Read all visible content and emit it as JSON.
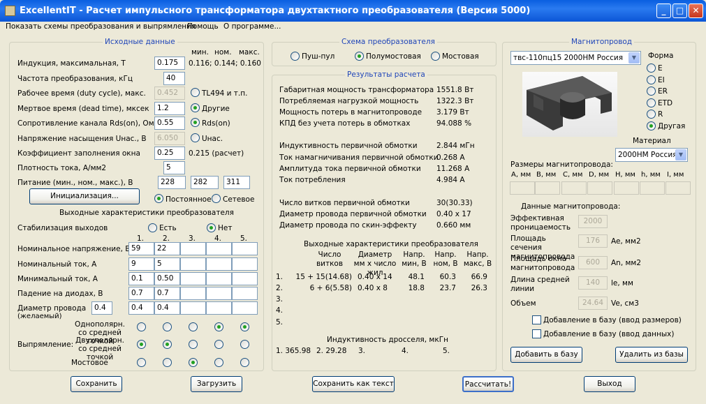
{
  "window": {
    "title": "ExcellentIT - Расчет импульсного трансформатора двухтактного преобразователя (Версия 5000)",
    "minimize": "_",
    "maximize": "□",
    "close": "✕"
  },
  "menu": {
    "schemes": "Показать схемы преобразования и выпрямления",
    "help": "Помощь",
    "about": "О программе..."
  },
  "input": {
    "title": "Исходные данные",
    "hdr_min": "мин.",
    "hdr_nom": "ном.",
    "hdr_max": "макс.",
    "induction_label": "Индукция, максимальная, Т",
    "induction_value": "0.175",
    "induction_range": "0.116; 0.144; 0.160",
    "freq_label": "Частота преобразования, кГц",
    "freq_value": "40",
    "duty_label": "Рабочее время (duty cycle), макс.",
    "duty_value": "0.452",
    "duty_opt": "TL494 и т.п.",
    "dead_label": "Мертвое время (dead time), мксек",
    "dead_value": "1.2",
    "dead_opt": "Другие",
    "rds_label": "Сопротивление канала Rds(on), Ом",
    "rds_value": "0.55",
    "rds_opt": "Rds(on)",
    "usat_label": "Напряжение насыщения Uнас., В",
    "usat_value": "6.050",
    "usat_opt": "Uнас.",
    "fill_label": "Коэффициент заполнения окна",
    "fill_value": "0.25",
    "fill_calc": "0.215 (расчет)",
    "current_density_label": "Плотность тока, А/мм2",
    "current_density_value": "5",
    "supply_label": "Питание (мин., ном., макс.), В",
    "supply_min": "228",
    "supply_nom": "282",
    "supply_max": "311",
    "init_button": "Инициализация...",
    "dc_opt": "Постоянное",
    "ac_opt": "Сетевое"
  },
  "outputs": {
    "title": "Выходные характеристики преобразователя",
    "stab_label": "Стабилизация выходов",
    "stab_yes": "Есть",
    "stab_no": "Нет",
    "col_nums": [
      "1.",
      "2.",
      "3.",
      "4.",
      "5."
    ],
    "rows": [
      {
        "label": "Номинальное напряжение, В",
        "values": [
          "59",
          "22",
          "",
          "",
          ""
        ]
      },
      {
        "label": "Номинальный ток, А",
        "values": [
          "9",
          "5",
          "",
          "",
          ""
        ]
      },
      {
        "label": "Минимальный ток, А",
        "values": [
          "0.1",
          "0.50",
          "",
          "",
          ""
        ]
      },
      {
        "label": "Падение на диодах, В",
        "values": [
          "0.7",
          "0.7",
          "",
          "",
          ""
        ]
      },
      {
        "label": "Диаметр провода",
        "values": [
          "0.4",
          "0.4",
          "",
          "",
          ""
        ]
      }
    ],
    "wire_desired": "(желаемый)",
    "wire_desired_value": "0.4",
    "rect_label": "Выпрямление:",
    "rect_opt1": "Однополярн. со средней точкой",
    "rect_opt2": "Двухполярн. со средней точкой",
    "rect_opt3": "Мостовое",
    "rect_selected": [
      2,
      2,
      3,
      1,
      1
    ]
  },
  "scheme": {
    "title": "Схема преобразователя",
    "push_pull": "Пуш-пул",
    "half_bridge": "Полумостовая",
    "bridge": "Мостовая"
  },
  "results": {
    "title": "Результаты расчета",
    "rows": [
      {
        "label": "Габаритная мощность трансформатора",
        "value": "1551.8 Вт"
      },
      {
        "label": "Потребляемая нагрузкой мощность",
        "value": "1322.3 Вт"
      },
      {
        "label": "Мощность потерь в магнитопроводе",
        "value": "3.179 Вт"
      },
      {
        "label": "КПД без учета потерь в обмотках",
        "value": "94.088 %"
      },
      {
        "label": "Индуктивность первичной обмотки",
        "value": "2.844 мГн"
      },
      {
        "label": "Ток намагничивания первичной обмотки",
        "value": "0.268 А"
      },
      {
        "label": "Амплитуда тока первичной обмотки",
        "value": "11.268 А"
      },
      {
        "label": "Ток потребления",
        "value": "4.984 А"
      },
      {
        "label": "Число витков первичной обмотки",
        "value": "30(30.33)"
      },
      {
        "label": "Диаметр провода первичной обмотки",
        "value": "0.40 x 17"
      },
      {
        "label": "Диаметр провода по скин-эффекту",
        "value": "0.660 мм"
      }
    ],
    "out_title": "Выходные характеристики преобразователя",
    "col1": "Число витков",
    "col2": "Диаметр мм х число жил",
    "col3": "Напр. мин, В",
    "col4": "Напр. ном, В",
    "col5": "Напр. макс, В",
    "out_rows": [
      {
        "n": "1.",
        "turns": "15 + 15(14.68)",
        "wire": "0.40 x 14",
        "vmin": "48.1",
        "vnom": "60.3",
        "vmax": "66.9"
      },
      {
        "n": "2.",
        "turns": "6 + 6(5.58)",
        "wire": "0.40 x 8",
        "vmin": "18.8",
        "vnom": "23.7",
        "vmax": "26.3"
      },
      {
        "n": "3.",
        "turns": "",
        "wire": "",
        "vmin": "",
        "vnom": "",
        "vmax": ""
      },
      {
        "n": "4.",
        "turns": "",
        "wire": "",
        "vmin": "",
        "vnom": "",
        "vmax": ""
      },
      {
        "n": "5.",
        "turns": "",
        "wire": "",
        "vmin": "",
        "vnom": "",
        "vmax": ""
      }
    ],
    "choke_title": "Индуктивность дросселя, мкГн",
    "choke_values": [
      "1. 365.98",
      "2. 29.28",
      "3.",
      "4.",
      "5."
    ]
  },
  "core": {
    "title": "Магнитопровод",
    "selected": "твс-110пц15 2000НМ Россия",
    "form_label": "Форма",
    "forms": [
      "E",
      "EI",
      "ER",
      "ETD",
      "R",
      "Другая"
    ],
    "material_label": "Материал",
    "material": "2000НМ Россия",
    "dims_label": "Размеры магнитопровода:",
    "dims": [
      "A, мм",
      "B, мм",
      "C, мм",
      "D, мм",
      "H, мм",
      "h, мм",
      "I, мм"
    ],
    "data_label": "Данные магнитопровода:",
    "perm_label": "Эффективная проницаемость",
    "perm_value": "2000",
    "ae_label": "Площадь сечения магнитопровода",
    "ae_value": "176",
    "ae_unit": "Ae, мм2",
    "an_label": "Площадь окна магнитопровода",
    "an_value": "600",
    "an_unit": "An, мм2",
    "le_label": "Длина средней линии",
    "le_value": "140",
    "le_unit": "le, мм",
    "ve_label": "Объем",
    "ve_value": "24.64",
    "ve_unit": "Ve, см3",
    "add_dims": "Добавление в базу (ввод размеров)",
    "add_data": "Добавление в базу (ввод данных)",
    "add_button": "Добавить в базу",
    "remove_button": "Удалить из базы"
  },
  "buttons": {
    "save": "Сохранить",
    "load": "Загрузить",
    "save_text": "Сохранить как текст",
    "calc": "Рассчитать!",
    "exit": "Выход"
  },
  "colors": {
    "title_bar": "#0a5fe0",
    "group_title": "#1f45b8",
    "radio_dot": "#21a121"
  }
}
